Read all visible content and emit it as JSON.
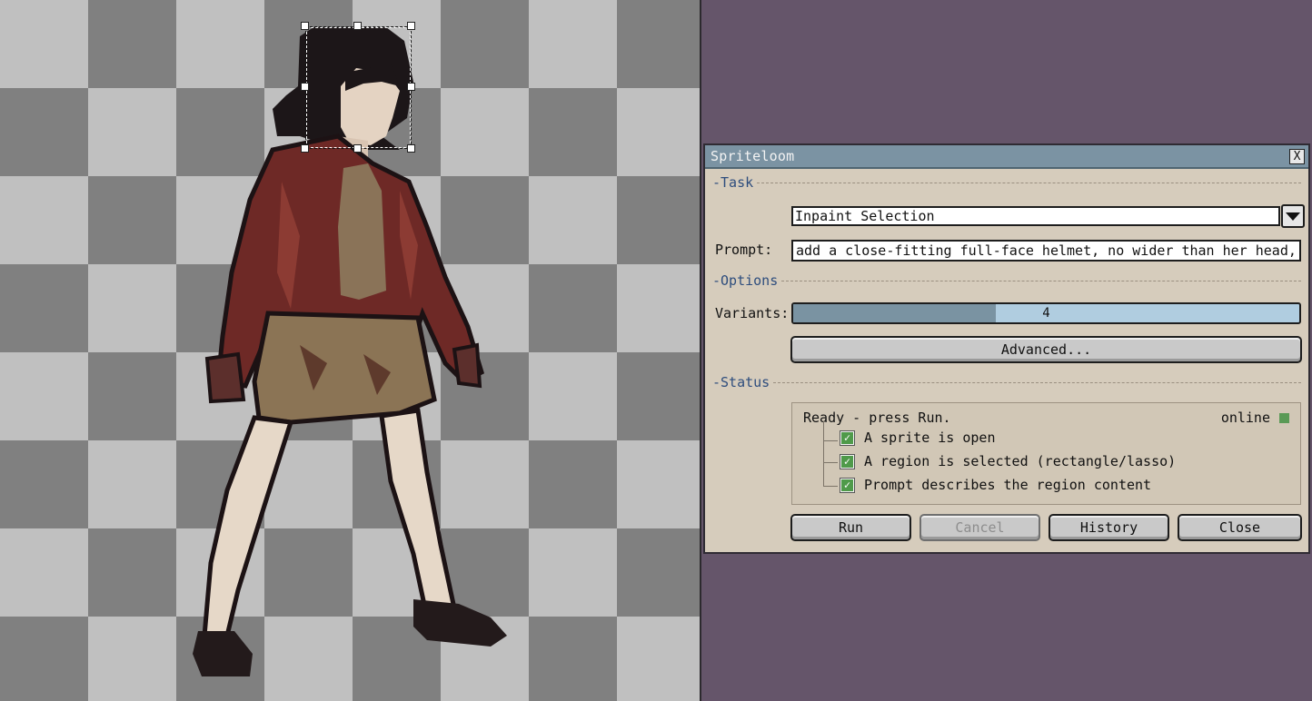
{
  "dialog": {
    "title": "Spriteloom",
    "close_glyph": "X",
    "sections": {
      "task": "-Task",
      "options": "-Options",
      "status": "-Status"
    },
    "task": {
      "selected": "Inpaint Selection"
    },
    "prompt": {
      "label": "Prompt:",
      "value": "add a close-fitting full-face helmet, no wider than her head, thin"
    },
    "variants": {
      "label": "Variants:",
      "value": "4",
      "fill_fraction": 0.4
    },
    "advanced_label": "Advanced...",
    "status": {
      "text": "Ready - press Run.",
      "connection": "online",
      "checks": [
        {
          "label": "A sprite is open",
          "checked": true
        },
        {
          "label": "A region is selected (rectangle/lasso)",
          "checked": true
        },
        {
          "label": "Prompt describes the region content",
          "checked": true
        }
      ]
    },
    "buttons": {
      "run": "Run",
      "cancel": "Cancel",
      "history": "History",
      "close": "Close"
    }
  },
  "colors": {
    "desktop": "#65556a",
    "dialog_bg": "#d6ccbc",
    "titlebar": "#7b93a3",
    "section_text": "#2e4d7d",
    "slider_fill": "#7a93a2",
    "slider_track": "#b0cde0",
    "online_indicator": "#5a9a56"
  }
}
